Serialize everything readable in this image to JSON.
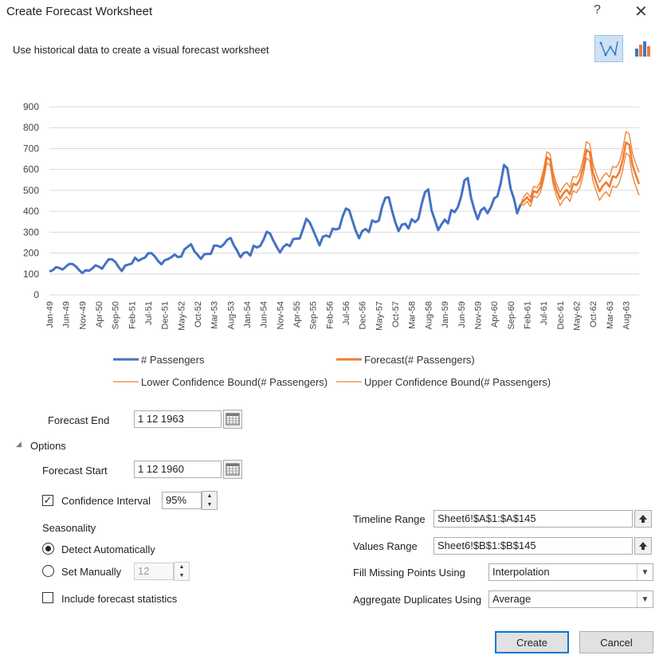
{
  "window": {
    "title": "Create Forecast Worksheet",
    "help": "?",
    "close": "✕"
  },
  "subtitle": "Use historical data to create a visual forecast worksheet",
  "chart_types": [
    {
      "name": "line-chart",
      "selected": true
    },
    {
      "name": "column-chart",
      "selected": false
    }
  ],
  "chart_data": {
    "type": "line",
    "yticks": [
      "0",
      "100",
      "200",
      "300",
      "400",
      "500",
      "600",
      "700",
      "800",
      "900"
    ],
    "ylim": [
      0,
      900
    ],
    "xticks": [
      "Jan-49",
      "Jun-49",
      "Nov-49",
      "Apr-50",
      "Sep-50",
      "Feb-51",
      "Jul-51",
      "Dec-51",
      "May-52",
      "Oct-52",
      "Mar-53",
      "Aug-53",
      "Jan-54",
      "Jun-54",
      "Nov-54",
      "Apr-55",
      "Sep-55",
      "Feb-56",
      "Jul-56",
      "Dec-56",
      "May-57",
      "Oct-57",
      "Mar-58",
      "Aug-58",
      "Jan-59",
      "Jun-59",
      "Nov-59",
      "Apr-60",
      "Sep-60",
      "Feb-61",
      "Jul-61",
      "Dec-61",
      "May-62",
      "Oct-62",
      "Mar-63",
      "Aug-63"
    ],
    "x_range": [
      "Jan-49",
      "Dec-63"
    ],
    "grid": true,
    "legend_position": "bottom",
    "colors": {
      "actual": "#4472c4",
      "forecast": "#ed7d31"
    },
    "series": [
      {
        "name": "# Passengers",
        "start_index": 0,
        "values": [
          112,
          118,
          132,
          129,
          121,
          135,
          148,
          148,
          136,
          119,
          104,
          118,
          115,
          126,
          141,
          135,
          125,
          149,
          170,
          170,
          158,
          133,
          114,
          140,
          145,
          150,
          178,
          163,
          172,
          178,
          199,
          199,
          184,
          162,
          146,
          166,
          171,
          180,
          193,
          181,
          183,
          218,
          230,
          242,
          209,
          191,
          172,
          194,
          196,
          196,
          236,
          235,
          229,
          243,
          264,
          272,
          237,
          211,
          180,
          201,
          204,
          188,
          235,
          227,
          234,
          264,
          302,
          293,
          259,
          229,
          203,
          229,
          242,
          233,
          267,
          269,
          270,
          315,
          364,
          347,
          312,
          274,
          237,
          278,
          284,
          277,
          317,
          313,
          318,
          374,
          413,
          405,
          355,
          306,
          271,
          306,
          315,
          301,
          356,
          348,
          355,
          422,
          465,
          467,
          404,
          347,
          305,
          336,
          340,
          318,
          362,
          348,
          363,
          435,
          491,
          505,
          404,
          359,
          310,
          337,
          360,
          342,
          406,
          396,
          420,
          472,
          548,
          559,
          463,
          407,
          362,
          405,
          417,
          391,
          419,
          461,
          472,
          535,
          622,
          606,
          508,
          461,
          390,
          432
        ]
      },
      {
        "name": "Forecast(# Passengers)",
        "start_index": 143,
        "values": [
          432,
          450,
          467,
          445,
          496,
          489,
          514,
          573,
          658,
          646,
          551,
          501,
          459,
          486,
          503,
          481,
          532,
          525,
          550,
          609,
          694,
          682,
          587,
          537,
          495,
          522,
          539,
          517,
          568,
          561,
          586,
          645,
          730,
          718,
          623,
          573,
          531
        ]
      },
      {
        "name": "Lower Confidence Bound(# Passengers)",
        "start_index": 143,
        "values": [
          432,
          430,
          446,
          423,
          473,
          465,
          489,
          547,
          631,
          618,
          522,
          471,
          428,
          454,
          470,
          447,
          497,
          489,
          513,
          571,
          655,
          642,
          546,
          495,
          452,
          478,
          494,
          471,
          521,
          513,
          537,
          595,
          679,
          666,
          570,
          519,
          476
        ]
      },
      {
        "name": "Upper Confidence Bound(# Passengers)",
        "start_index": 143,
        "values": [
          432,
          470,
          488,
          467,
          519,
          513,
          539,
          599,
          685,
          674,
          580,
          531,
          490,
          518,
          536,
          515,
          567,
          561,
          587,
          647,
          733,
          722,
          628,
          579,
          538,
          566,
          584,
          563,
          615,
          609,
          635,
          695,
          781,
          770,
          676,
          627,
          586
        ]
      }
    ]
  },
  "form": {
    "forecast_end_label": "Forecast End",
    "forecast_end_value": "1 12 1963",
    "options_label": "Options",
    "forecast_start_label": "Forecast Start",
    "forecast_start_value": "1 12 1960",
    "confidence_label": "Confidence Interval",
    "confidence_checked": true,
    "confidence_value": "95%",
    "seasonality_label": "Seasonality",
    "detect_label": "Detect Automatically",
    "set_manually_label": "Set Manually",
    "set_manually_value": "12",
    "stats_label": "Include forecast statistics",
    "timeline_label": "Timeline Range",
    "timeline_value": "Sheet6!$A$1:$A$145",
    "values_label": "Values Range",
    "values_value": "Sheet6!$B$1:$B$145",
    "fill_label": "Fill Missing Points Using",
    "fill_value": "Interpolation",
    "aggregate_label": "Aggregate Duplicates Using",
    "aggregate_value": "Average"
  },
  "buttons": {
    "create": "Create",
    "cancel": "Cancel"
  }
}
